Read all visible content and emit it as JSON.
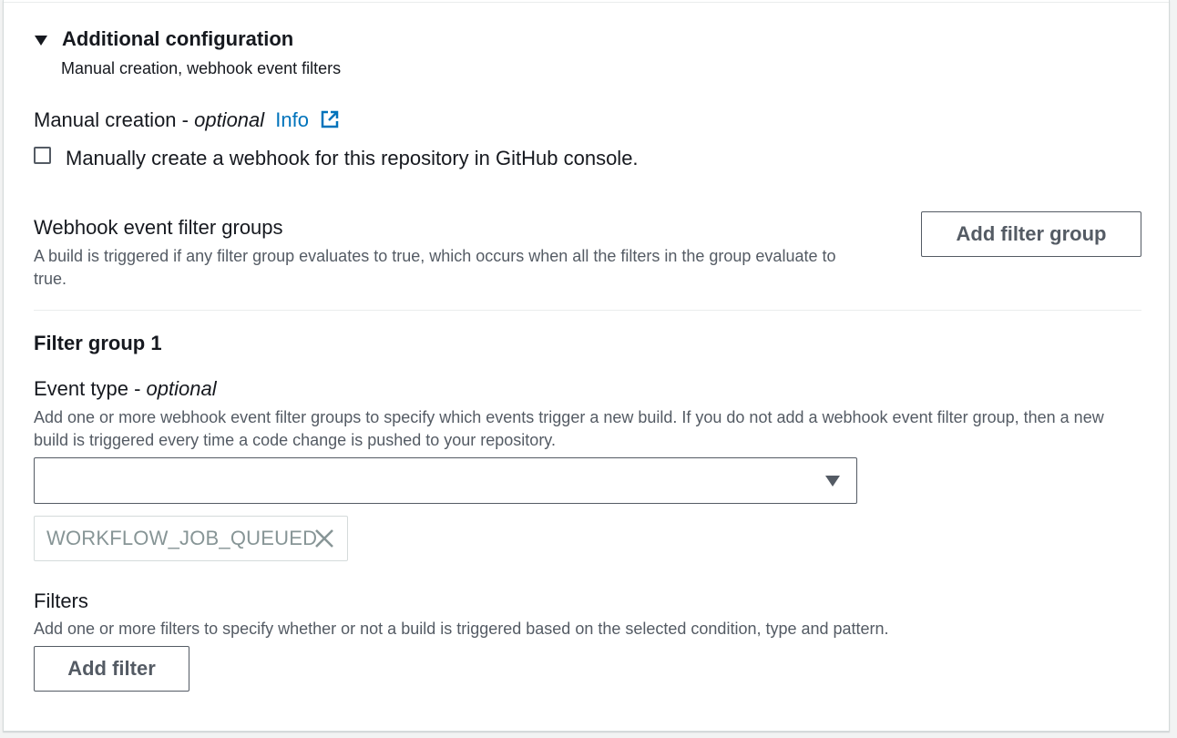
{
  "additional_config": {
    "title": "Additional configuration",
    "description": "Manual creation, webhook event filters"
  },
  "manual_creation": {
    "label": "Manual creation - ",
    "optional": "optional",
    "info_link": "Info",
    "checkbox_label": "Manually create a webhook for this repository in GitHub console.",
    "checked": false
  },
  "webhook_groups": {
    "title": "Webhook event filter groups",
    "description": "A build is triggered if any filter group evaluates to true, which occurs when all the filters in the group evaluate to true.",
    "add_group_button": "Add filter group"
  },
  "filter_group": {
    "title": "Filter group 1",
    "event_type_label": "Event type - ",
    "event_type_optional": "optional",
    "event_type_description": "Add one or more webhook event filter groups to specify which events trigger a new build. If you do not add a webhook event filter group, then a new build is triggered every time a code change is pushed to your repository.",
    "event_type_selected": "",
    "tokens": [
      "WORKFLOW_JOB_QUEUED"
    ],
    "filters_label": "Filters",
    "filters_description": "Add one or more filters to specify whether or not a build is triggered based on the selected condition, type and pattern.",
    "add_filter_button": "Add filter"
  },
  "icons": {
    "expander": "caret-down-icon",
    "external_link": "external-link-icon",
    "select_caret": "caret-down-icon",
    "token_remove": "close-icon"
  },
  "colors": {
    "link": "#0073bb",
    "text": "#16191f",
    "secondary_text": "#545b64",
    "token_text": "#879596"
  }
}
